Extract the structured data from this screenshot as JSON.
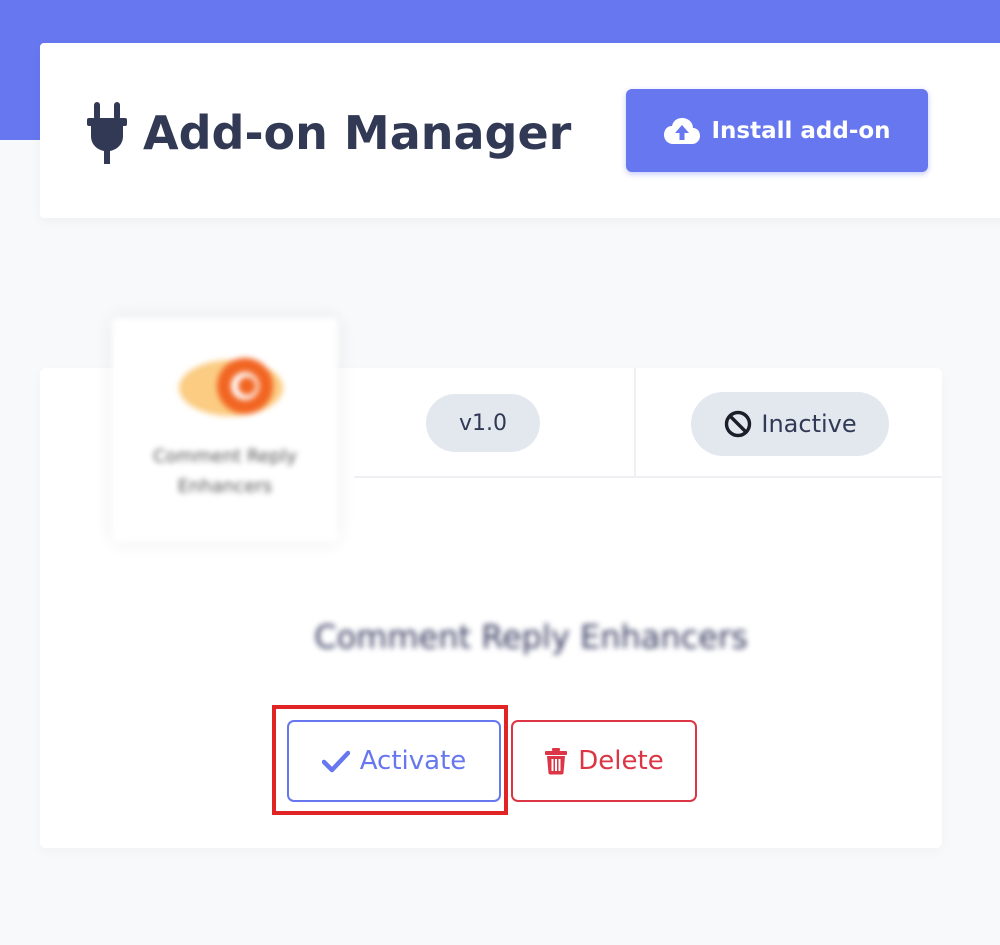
{
  "header": {
    "title": "Add-on Manager",
    "title_icon": "plug-icon",
    "install_button_label": "Install add-on",
    "install_button_icon": "cloud-upload-icon"
  },
  "addon": {
    "name": "Comment Reply Enhancers",
    "thumbnail_caption": "Comment Reply Enhancers",
    "version": "v1.0",
    "status": "Inactive",
    "status_icon": "ban-icon",
    "activate_label": "Activate",
    "activate_icon": "check-icon",
    "delete_label": "Delete",
    "delete_icon": "trash-icon"
  },
  "colors": {
    "accent": "#6777ef",
    "danger": "#dc3545",
    "highlight": "#e02424",
    "badge_bg": "#e3e8ef",
    "title_text": "#313955",
    "page_bg": "#f8f9fa"
  }
}
